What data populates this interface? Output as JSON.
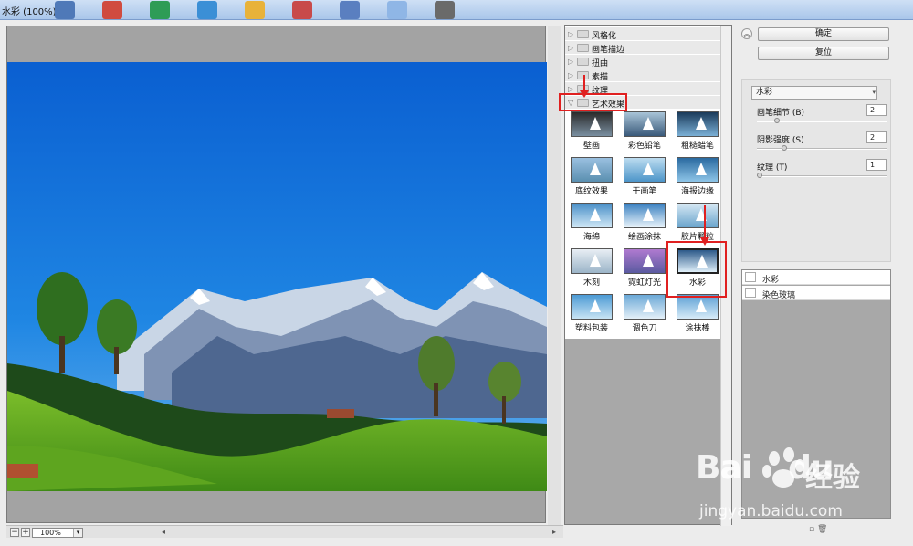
{
  "window": {
    "title": "水彩 (100%)"
  },
  "taskbar": {
    "icons": [
      {
        "name": "app-icon-1",
        "color": "#4f79b8"
      },
      {
        "name": "app-icon-2",
        "color": "#d04b3f"
      },
      {
        "name": "app-icon-3",
        "color": "#2e9c56"
      },
      {
        "name": "app-icon-4",
        "color": "#3b8fd6"
      },
      {
        "name": "app-icon-5",
        "color": "#e8b23a"
      },
      {
        "name": "app-icon-6",
        "color": "#c84a4a"
      },
      {
        "name": "app-icon-7",
        "color": "#5a7fc0"
      },
      {
        "name": "app-icon-8",
        "color": "#8fb6e6"
      },
      {
        "name": "app-icon-9",
        "color": "#6a6a6a"
      }
    ]
  },
  "preview": {
    "zoom": "100%",
    "zoom_minus": "−",
    "zoom_plus": "+",
    "scroll_left": "◂",
    "scroll_right": "▸"
  },
  "filters": {
    "categories": [
      {
        "label": "风格化",
        "expanded": false
      },
      {
        "label": "画笔描边",
        "expanded": false
      },
      {
        "label": "扭曲",
        "expanded": false
      },
      {
        "label": "素描",
        "expanded": false
      },
      {
        "label": "纹理",
        "expanded": false
      },
      {
        "label": "艺术效果",
        "expanded": true
      }
    ],
    "artistic": [
      {
        "label": "壁画"
      },
      {
        "label": "彩色铅笔"
      },
      {
        "label": "粗糙蜡笔"
      },
      {
        "label": "底纹效果"
      },
      {
        "label": "干画笔"
      },
      {
        "label": "海报边缘"
      },
      {
        "label": "海绵"
      },
      {
        "label": "绘画涂抹"
      },
      {
        "label": "胶片颗粒"
      },
      {
        "label": "木刻"
      },
      {
        "label": "霓虹灯光"
      },
      {
        "label": "水彩",
        "selected": true
      },
      {
        "label": "塑料包装"
      },
      {
        "label": "调色刀"
      },
      {
        "label": "涂抹棒"
      }
    ]
  },
  "settings": {
    "ok_label": "确定",
    "reset_label": "复位",
    "filter_select": "水彩",
    "params": [
      {
        "label": "画笔细节 (B)",
        "value": "2",
        "level": 0.14
      },
      {
        "label": "阴影强度 (S)",
        "value": "2",
        "level": 0.2
      },
      {
        "label": "纹理 (T)",
        "value": "1",
        "level": 0.0
      }
    ]
  },
  "layers": {
    "items": [
      {
        "label": "水彩"
      },
      {
        "label": "染色玻璃"
      }
    ]
  },
  "watermark": {
    "brand": "Bai",
    "brand2": "du",
    "cn": "经验",
    "url": "jingyan.baidu.com"
  },
  "colors": {
    "highlight": "#e02020",
    "sky": "#1a6fd6"
  }
}
